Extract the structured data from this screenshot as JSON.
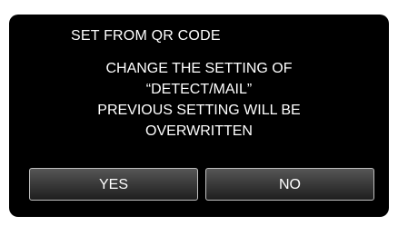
{
  "dialog": {
    "title": "SET FROM QR CODE",
    "message_lines": [
      "CHANGE THE SETTING OF",
      "“DETECT/MAIL”",
      "PREVIOUS SETTING WILL BE",
      "OVERWRITTEN"
    ],
    "buttons": {
      "yes_label": "YES",
      "no_label": "NO"
    }
  },
  "colors": {
    "panel_background": "#000000",
    "text": "#ffffff",
    "button_border": "#bfbfbf"
  }
}
